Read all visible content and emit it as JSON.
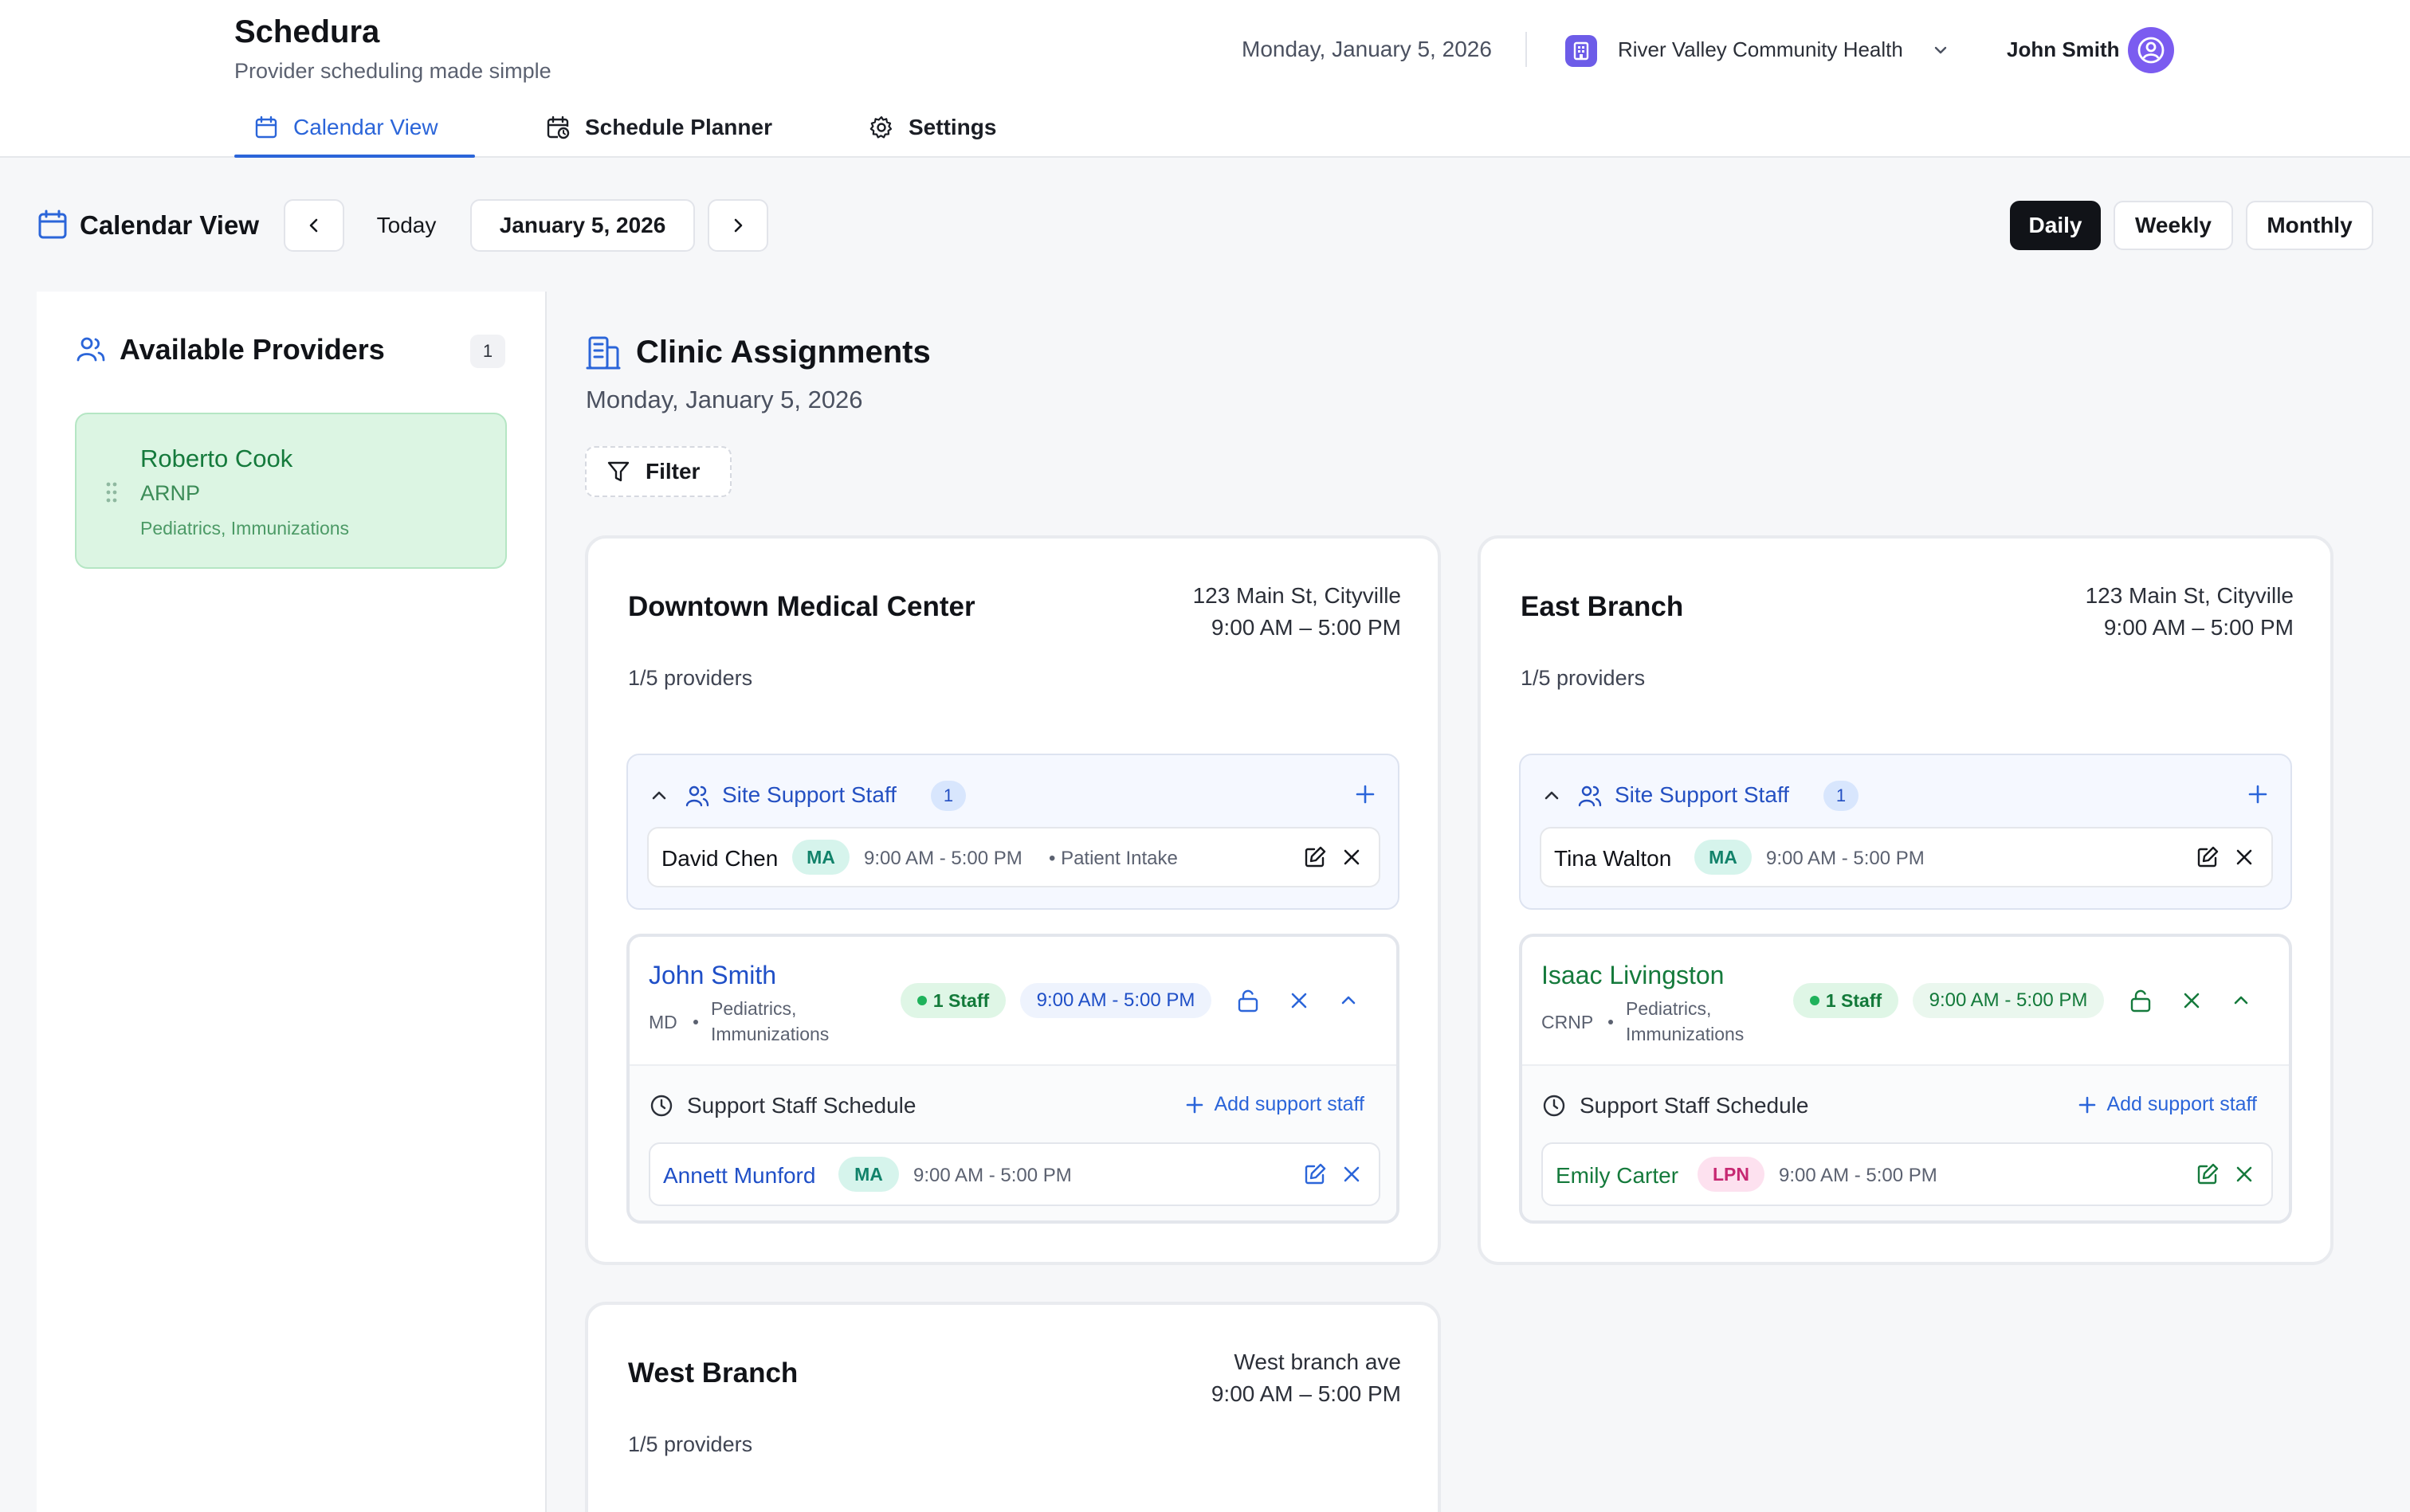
{
  "header": {
    "app_name": "Schedura",
    "tagline": "Provider scheduling made simple",
    "date": "Monday, January 5, 2026",
    "organization": "River Valley Community Health",
    "user_name": "John Smith",
    "brand_color": "#6d5ce8",
    "avatar_color": "#7b5cf0"
  },
  "tabs": [
    {
      "label": "Calendar View",
      "icon": "calendar-icon",
      "active": true
    },
    {
      "label": "Schedule Planner",
      "icon": "calendar-clock-icon",
      "active": false
    },
    {
      "label": "Settings",
      "icon": "gear-icon",
      "active": false
    }
  ],
  "toolbar": {
    "title": "Calendar View",
    "today_label": "Today",
    "current_date": "January 5, 2026",
    "views": [
      {
        "label": "Daily",
        "active": true
      },
      {
        "label": "Weekly",
        "active": false
      },
      {
        "label": "Monthly",
        "active": false
      }
    ]
  },
  "sidebar": {
    "title": "Available Providers",
    "count": "1",
    "providers": [
      {
        "name": "Roberto Cook",
        "role": "ARNP",
        "specialties": "Pediatrics, Immunizations"
      }
    ]
  },
  "main": {
    "title": "Clinic Assignments",
    "date": "Monday, January 5, 2026",
    "filter_label": "Filter",
    "clinics": [
      {
        "name": "Downtown Medical Center",
        "address": "123 Main St, Cityville",
        "hours": "9:00 AM – 5:00 PM",
        "provider_count": "1/5 providers",
        "site_support": {
          "title": "Site Support Staff",
          "count": "1",
          "staff": [
            {
              "name": "David Chen",
              "role": "MA",
              "time": "9:00 AM - 5:00 PM",
              "note": "• Patient Intake"
            }
          ]
        },
        "provider": {
          "name": "John Smith",
          "role": "MD",
          "specialties": "Pediatrics, Immunizations",
          "staff_count": "1 Staff",
          "time": "9:00 AM - 5:00 PM",
          "support_title": "Support Staff Schedule",
          "add_label": "Add support staff",
          "staff": [
            {
              "name": "Annett Munford",
              "role": "MA",
              "time": "9:00 AM - 5:00 PM"
            }
          ]
        }
      },
      {
        "name": "East Branch",
        "address": "123 Main St, Cityville",
        "hours": "9:00 AM – 5:00 PM",
        "provider_count": "1/5 providers",
        "site_support": {
          "title": "Site Support Staff",
          "count": "1",
          "staff": [
            {
              "name": "Tina Walton",
              "role": "MA",
              "time": "9:00 AM - 5:00 PM"
            }
          ]
        },
        "provider": {
          "name": "Isaac Livingston",
          "role": "CRNP",
          "specialties": "Pediatrics, Immunizations",
          "staff_count": "1 Staff",
          "time": "9:00 AM - 5:00 PM",
          "support_title": "Support Staff Schedule",
          "add_label": "Add support staff",
          "staff": [
            {
              "name": "Emily Carter",
              "role": "LPN",
              "time": "9:00 AM - 5:00 PM"
            }
          ]
        }
      },
      {
        "name": "West Branch",
        "address": "West branch ave",
        "hours": "9:00 AM – 5:00 PM",
        "provider_count": "1/5 providers"
      }
    ]
  }
}
